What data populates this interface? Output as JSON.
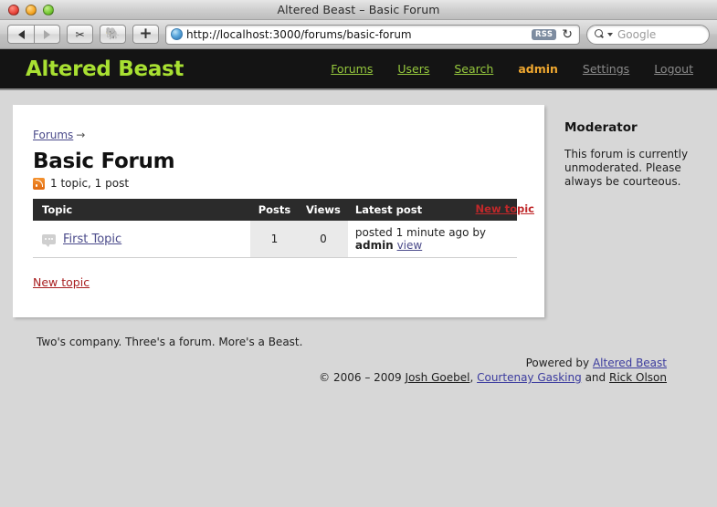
{
  "browser": {
    "window_title": "Altered Beast – Basic Forum",
    "traffic_lights": [
      "close",
      "minimize",
      "zoom"
    ],
    "back_label": "◀",
    "forward_label": "▶",
    "snippet_icon": "✂",
    "evernote_icon": "🐘",
    "add_tab_label": "+",
    "url": "http://localhost:3000/forums/basic-forum",
    "rss_badge": "RSS",
    "reload_icon": "↻",
    "search_placeholder": "Google"
  },
  "site": {
    "logo": "Altered Beast",
    "nav": [
      {
        "label": "Forums",
        "style": "green"
      },
      {
        "label": "Users",
        "style": "green"
      },
      {
        "label": "Search",
        "style": "green"
      },
      {
        "label": "admin",
        "style": "user"
      },
      {
        "label": "Settings",
        "style": "dim"
      },
      {
        "label": "Logout",
        "style": "dim"
      }
    ]
  },
  "breadcrumb": {
    "root": "Forums",
    "arrow": "→"
  },
  "forum": {
    "title": "Basic Forum",
    "stats": "1 topic, 1 post",
    "rss_icon": "rss-icon"
  },
  "table": {
    "headers": {
      "topic": "Topic",
      "posts": "Posts",
      "views": "Views",
      "latest": "Latest post"
    },
    "header_action": "New topic",
    "rows": [
      {
        "topic": "First Topic",
        "posts": "1",
        "views": "0",
        "latest_prefix": "posted 1 minute ago by",
        "latest_author": "admin",
        "latest_view": "view"
      }
    ]
  },
  "actions": {
    "new_topic": "New topic"
  },
  "sidebar": {
    "title": "Moderator",
    "body": "This forum is currently unmoderated.\nPlease always be courteous."
  },
  "footer": {
    "tagline": "Two's company. Three's a forum. More's a Beast.",
    "powered_prefix": "Powered by",
    "powered_link": "Altered Beast",
    "copyright_prefix": "© 2006 – 2009",
    "author1": "Josh Goebel",
    "comma": ",",
    "author2": "Courtenay Gasking",
    "and": "and",
    "author3": "Rick Olson"
  },
  "colors": {
    "logo_green": "#a8e032",
    "nav_green": "#96c93d",
    "user_orange": "#f0a830",
    "link_red": "#a81f20",
    "header_black": "#141414",
    "page_gray": "#d7d7d7"
  }
}
